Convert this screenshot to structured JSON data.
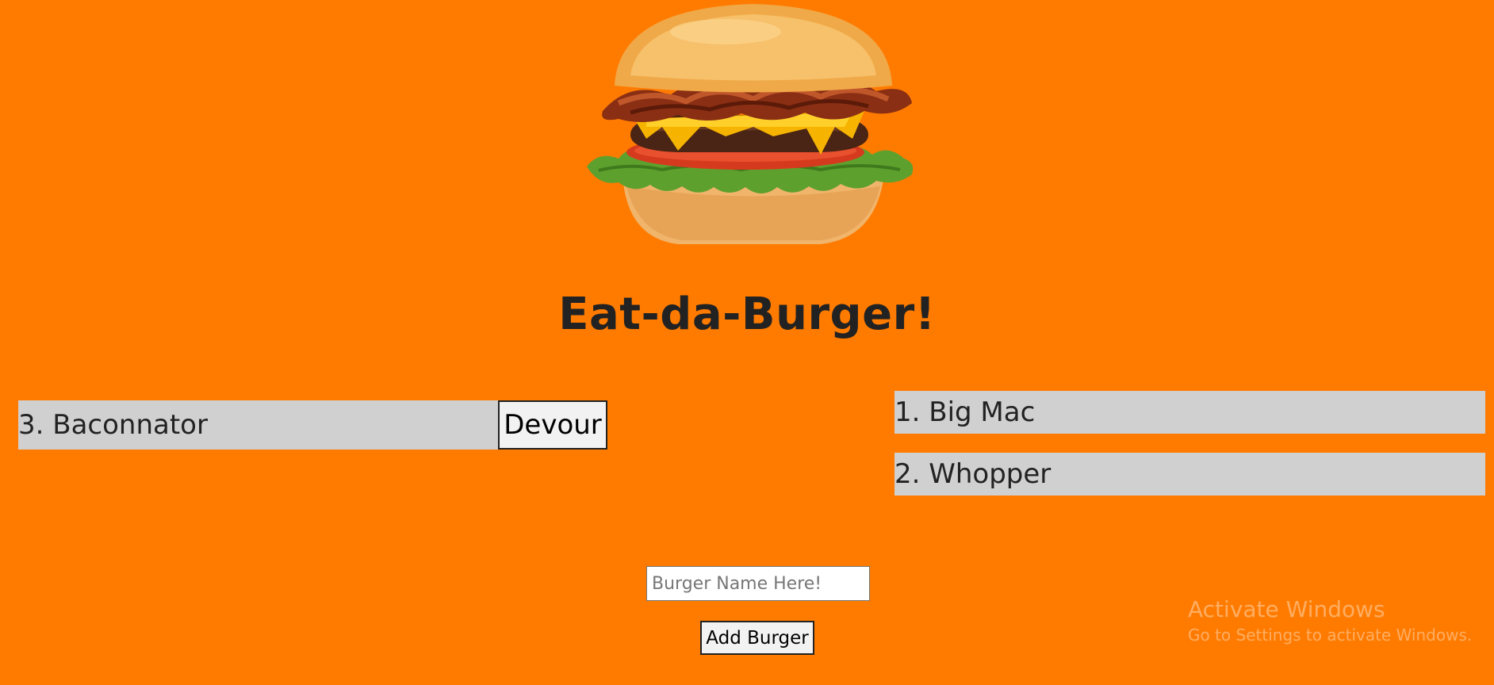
{
  "page": {
    "title": "Eat-da-Burger!",
    "background_color": "#ff7b00"
  },
  "hero_image": {
    "icon": "burger-image"
  },
  "uneaten": {
    "items": [
      {
        "label": "3. Baconnator",
        "button_label": "Devour"
      }
    ]
  },
  "devoured": {
    "items": [
      {
        "label": "1. Big Mac"
      },
      {
        "label": "2. Whopper"
      }
    ]
  },
  "form": {
    "input_placeholder": "Burger Name Here!",
    "input_value": "",
    "submit_label": "Add Burger"
  },
  "watermark": {
    "title": "Activate Windows",
    "subtitle": "Go to Settings to activate Windows."
  }
}
